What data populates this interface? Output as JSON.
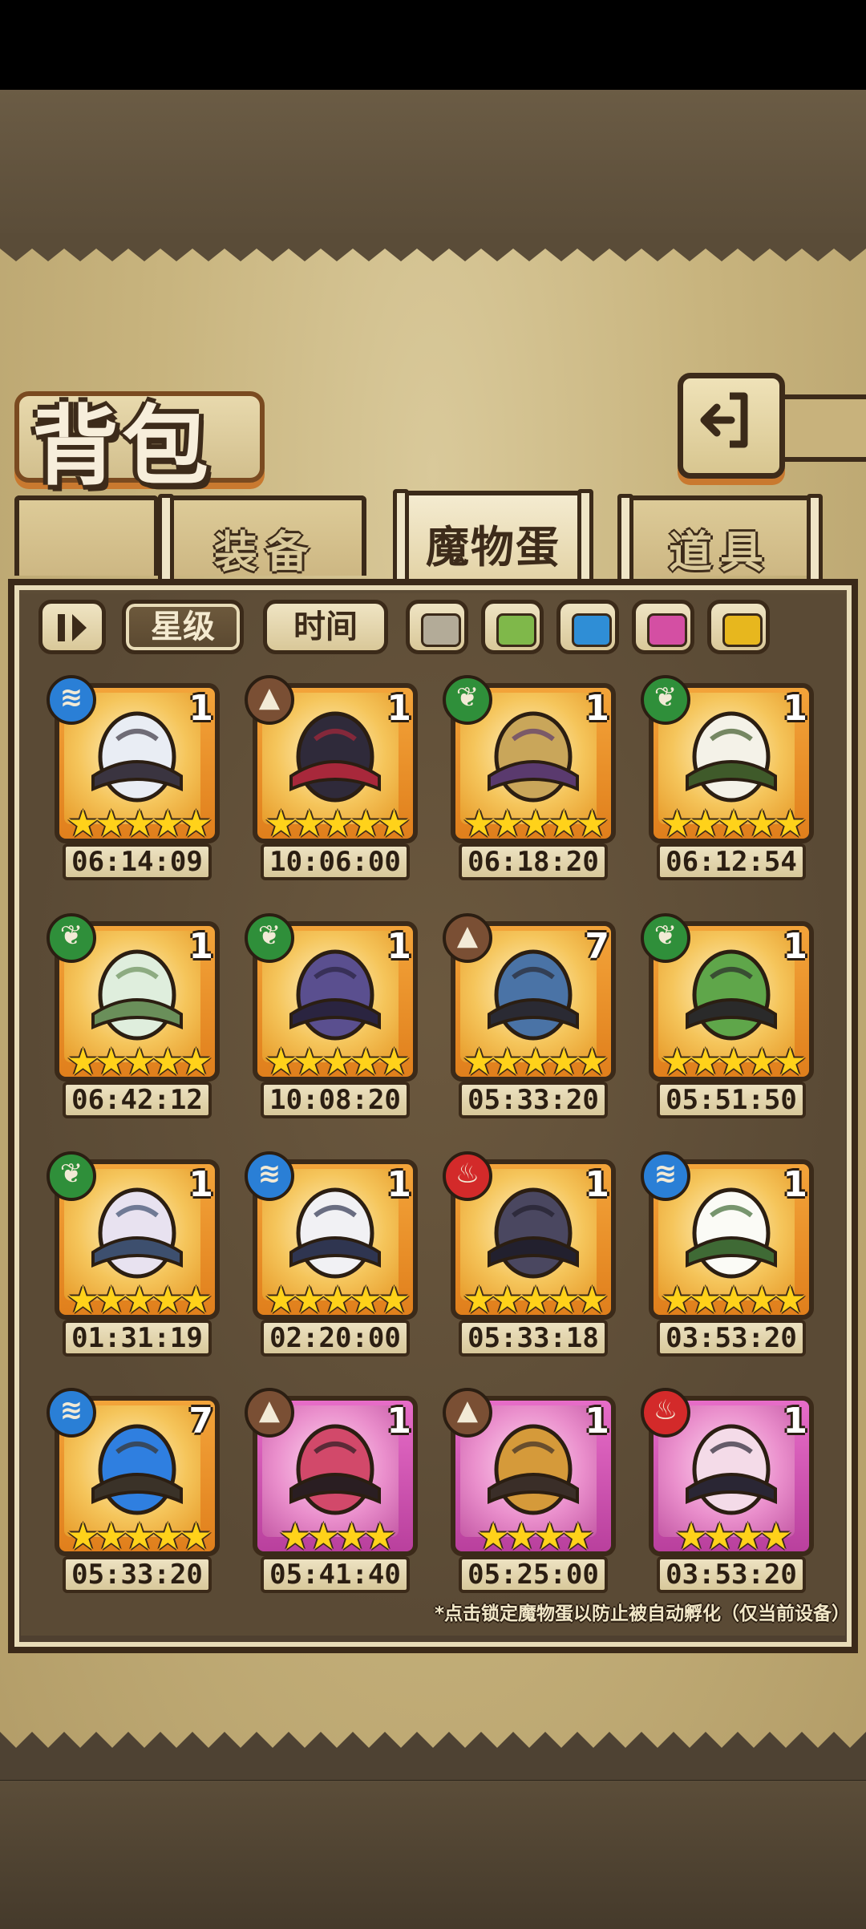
{
  "header": {
    "title": "背包",
    "back_icon": "back-arrow-icon"
  },
  "tabs": [
    {
      "label": "装备",
      "active": false
    },
    {
      "label": "魔物蛋",
      "active": true
    },
    {
      "label": "道具",
      "active": false
    }
  ],
  "filters": {
    "sort_toggle_icon": "sort-order-icon",
    "star_label": "星级",
    "time_label": "时间",
    "colors": [
      "#b3ab98",
      "#7fb84a",
      "#2f8ed6",
      "#d44fa3",
      "#e7b71e"
    ]
  },
  "eggs": [
    {
      "count": "1",
      "element": "water",
      "stars": "★★★★★",
      "timer": "06:14:09",
      "rarity": "legendary",
      "icon": "white-crystal-egg-icon"
    },
    {
      "count": "1",
      "element": "earth",
      "stars": "★★★★★",
      "timer": "10:06:00",
      "rarity": "legendary",
      "icon": "coffin-egg-icon"
    },
    {
      "count": "1",
      "element": "leaf",
      "stars": "★★★★★",
      "timer": "06:18:20",
      "rarity": "legendary",
      "icon": "magic-lamp-egg-icon"
    },
    {
      "count": "1",
      "element": "leaf",
      "stars": "★★★★★",
      "timer": "06:12:54",
      "rarity": "legendary",
      "icon": "winged-egg-icon"
    },
    {
      "count": "1",
      "element": "leaf",
      "stars": "★★★★★",
      "timer": "06:42:12",
      "rarity": "legendary",
      "icon": "leaf-egg-icon"
    },
    {
      "count": "1",
      "element": "leaf",
      "stars": "★★★★★",
      "timer": "10:08:20",
      "rarity": "legendary",
      "icon": "dark-rune-egg-icon"
    },
    {
      "count": "7",
      "element": "earth",
      "stars": "★★★★★",
      "timer": "05:33:20",
      "rarity": "legendary",
      "icon": "hammer-icon"
    },
    {
      "count": "1",
      "element": "leaf",
      "stars": "★★★★★",
      "timer": "05:51:50",
      "rarity": "legendary",
      "icon": "chained-lantern-egg-icon"
    },
    {
      "count": "1",
      "element": "leaf",
      "stars": "★★★★★",
      "timer": "01:31:19",
      "rarity": "legendary",
      "icon": "spotted-egg-icon"
    },
    {
      "count": "1",
      "element": "water",
      "stars": "★★★★★",
      "timer": "02:20:00",
      "rarity": "legendary",
      "icon": "cloud-egg-icon"
    },
    {
      "count": "1",
      "element": "fire",
      "stars": "★★★★★",
      "timer": "05:33:18",
      "rarity": "legendary",
      "icon": "demon-egg-icon"
    },
    {
      "count": "1",
      "element": "water",
      "stars": "★★★★★",
      "timer": "03:53:20",
      "rarity": "legendary",
      "icon": "vine-egg-icon"
    },
    {
      "count": "7",
      "element": "water",
      "stars": "★★★★★",
      "timer": "05:33:20",
      "rarity": "legendary",
      "icon": "sword-icon"
    },
    {
      "count": "1",
      "element": "earth",
      "stars": "★★★★",
      "timer": "05:41:40",
      "rarity": "epic",
      "icon": "thorn-eye-egg-icon"
    },
    {
      "count": "1",
      "element": "earth",
      "stars": "★★★★",
      "timer": "05:25:00",
      "rarity": "epic",
      "icon": "furry-gem-egg-icon"
    },
    {
      "count": "1",
      "element": "fire",
      "stars": "★★★★",
      "timer": "03:53:20",
      "rarity": "epic",
      "icon": "bat-wing-egg-icon"
    }
  ],
  "footnote": "*点击锁定魔物蛋以防止被自动孵化（仅当前设备）"
}
